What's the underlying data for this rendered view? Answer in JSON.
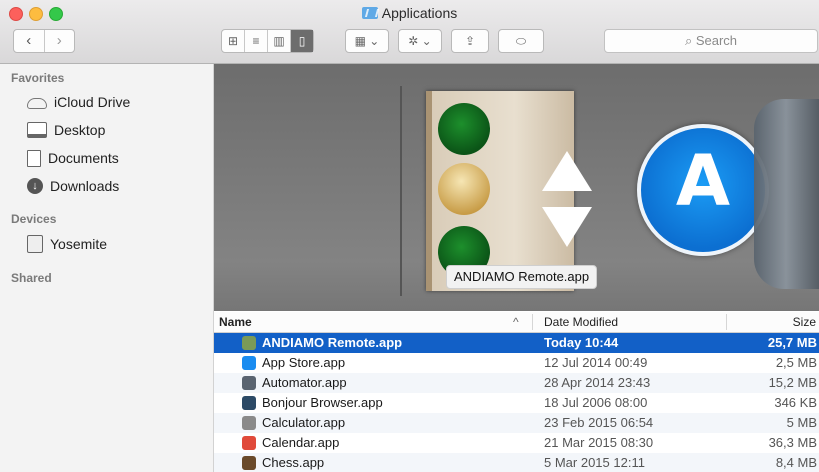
{
  "window": {
    "title": "Applications",
    "nav_back": "‹",
    "nav_forward": "›",
    "search_placeholder": "Search"
  },
  "toolbar": {
    "view_icons": "⊞",
    "view_list": "≡",
    "view_columns": "▥",
    "view_coverflow": "▯",
    "arrange": "▦ ⌄",
    "action": "✲ ⌄",
    "share": "⇪",
    "tag": "⬭"
  },
  "sidebar": {
    "sections": [
      {
        "title": "Favorites"
      },
      {
        "title": "Devices"
      },
      {
        "title": "Shared"
      }
    ],
    "favorites": [
      {
        "label": "iCloud Drive",
        "icon": "cloud-icon"
      },
      {
        "label": "Desktop",
        "icon": "desktop-icon"
      },
      {
        "label": "Documents",
        "icon": "documents-icon"
      },
      {
        "label": "Downloads",
        "icon": "downloads-icon"
      }
    ],
    "devices": [
      {
        "label": "Yosemite",
        "icon": "disk-icon"
      }
    ],
    "down_glyph": "↓"
  },
  "coverflow": {
    "selected_label": "ANDIAMO Remote.app",
    "appstore_glyph": "A"
  },
  "list": {
    "columns": {
      "name": "Name",
      "sort_indicator": "^",
      "date": "Date Modified",
      "size": "Size"
    },
    "rows": [
      {
        "name": "ANDIAMO Remote.app",
        "date": "Today 10:44",
        "size": "25,7 MB",
        "selected": true,
        "color": "#7a9a58"
      },
      {
        "name": "App Store.app",
        "date": "12 Jul 2014 00:49",
        "size": "2,5 MB",
        "color": "#1a8cf0"
      },
      {
        "name": "Automator.app",
        "date": "28 Apr 2014 23:43",
        "size": "15,2 MB",
        "color": "#5a6470"
      },
      {
        "name": "Bonjour Browser.app",
        "date": "18 Jul 2006 08:00",
        "size": "346 KB",
        "color": "#2c4a66"
      },
      {
        "name": "Calculator.app",
        "date": "23 Feb 2015 06:54",
        "size": "5 MB",
        "color": "#8a8a8a"
      },
      {
        "name": "Calendar.app",
        "date": "21 Mar 2015 08:30",
        "size": "36,3 MB",
        "color": "#e04a3a"
      },
      {
        "name": "Chess.app",
        "date": "5 Mar 2015 12:11",
        "size": "8,4 MB",
        "color": "#6a4a2a"
      }
    ]
  }
}
